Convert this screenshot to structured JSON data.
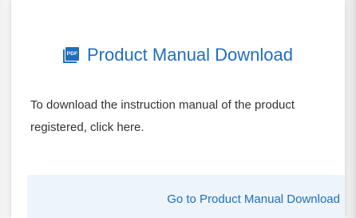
{
  "card": {
    "title": "Product Manual Download",
    "icon": "pdf-icon",
    "icon_text": "PDF",
    "description": "To download the instruction manual of the product registered, click here.",
    "link_label": "Go to Product Manual Download"
  },
  "colors": {
    "accent": "#1f6fbf",
    "link_bar_bg": "#edf4fb",
    "text": "#333333"
  }
}
